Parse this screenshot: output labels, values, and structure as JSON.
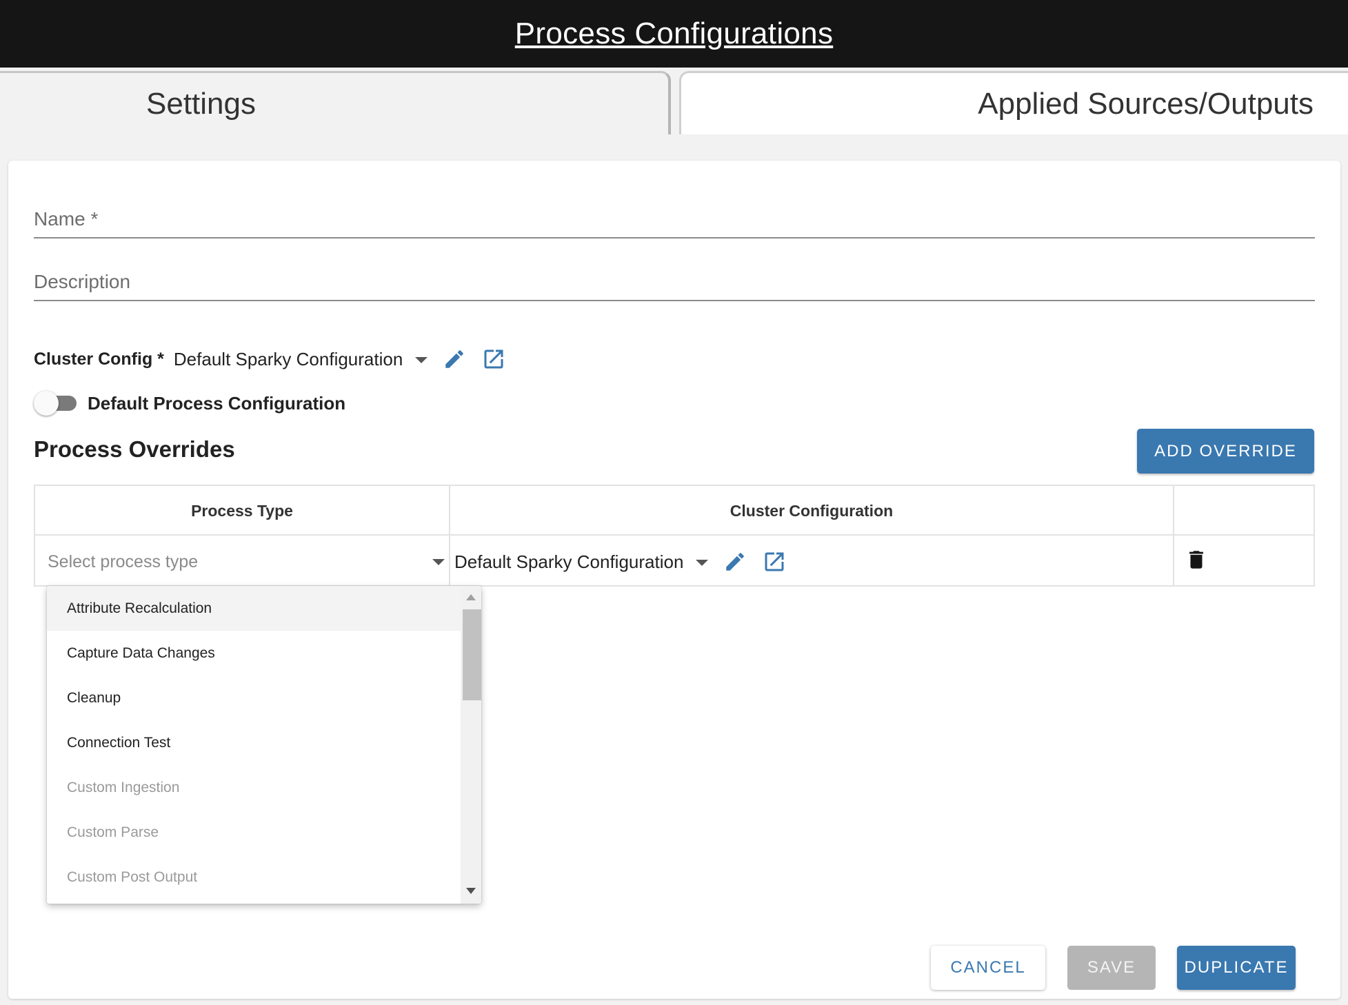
{
  "header": {
    "title": "Process Configurations"
  },
  "tabs": [
    {
      "label": "Settings",
      "active": true
    },
    {
      "label": "Applied Sources/Outputs",
      "active": false
    }
  ],
  "form": {
    "name_label": "Name *",
    "description_label": "Description",
    "cluster_config_label": "Cluster Config *",
    "cluster_config_value": "Default Sparky Configuration",
    "default_toggle_label": "Default Process Configuration",
    "default_toggle_on": false
  },
  "overrides": {
    "title": "Process Overrides",
    "add_button": "ADD OVERRIDE",
    "columns": [
      "Process Type",
      "Cluster Configuration",
      ""
    ],
    "row": {
      "process_type_placeholder": "Select process type",
      "cluster_configuration": "Default Sparky Configuration"
    },
    "dropdown_options": [
      {
        "label": "Attribute Recalculation",
        "enabled": true,
        "highlighted": true
      },
      {
        "label": "Capture Data Changes",
        "enabled": true
      },
      {
        "label": "Cleanup",
        "enabled": true
      },
      {
        "label": "Connection Test",
        "enabled": true
      },
      {
        "label": "Custom Ingestion",
        "enabled": false
      },
      {
        "label": "Custom Parse",
        "enabled": false
      },
      {
        "label": "Custom Post Output",
        "enabled": false
      }
    ]
  },
  "actions": {
    "cancel": "CANCEL",
    "save": "SAVE",
    "duplicate": "DUPLICATE"
  },
  "colors": {
    "accent": "#3a78b0",
    "header_bg": "#151515",
    "disabled": "#b5b5b5"
  },
  "icons": [
    "pencil-icon",
    "open-in-new-icon",
    "caret-down-icon",
    "trash-icon"
  ]
}
